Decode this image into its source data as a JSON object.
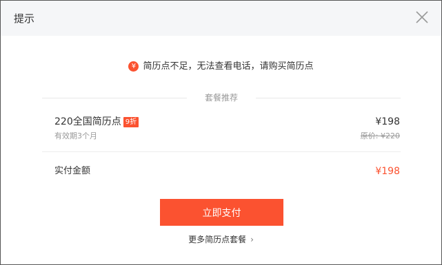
{
  "dialog": {
    "title": "提示",
    "notice_icon": "¥",
    "notice_text": "简历点不足，无法查看电话，请购买简历点",
    "section_label": "套餐推荐",
    "package": {
      "name": "220全国简历点",
      "discount": "9折",
      "validity": "有效期3个月",
      "price": "¥198",
      "original_price": "原价: ¥220"
    },
    "payment": {
      "label": "实付金额",
      "amount": "¥198"
    },
    "pay_button": "立即支付",
    "more_link": "更多简历点套餐",
    "more_chevron": "›"
  },
  "colors": {
    "accent": "#fb5230",
    "header_bg": "#f5f6f8"
  }
}
